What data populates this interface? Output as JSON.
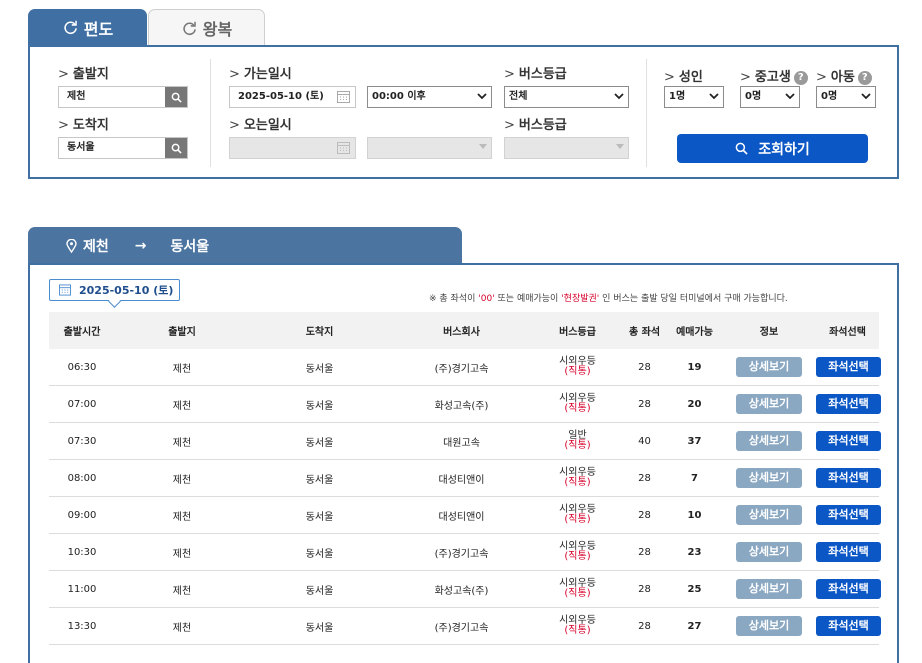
{
  "tabs": {
    "oneway": "편도",
    "roundtrip": "왕복"
  },
  "search": {
    "departure_label": "출발지",
    "departure_value": "제천",
    "arrival_label": "도착지",
    "arrival_value": "동서울",
    "go_date_label": "가는일시",
    "go_date_value": "2025-05-10 (토)",
    "go_time_value": "00:00 이후",
    "return_date_label": "오는일시",
    "grade_label": "버스등급",
    "grade_value": "전체",
    "grade_label2": "버스등급",
    "adult_label": "성인",
    "adult_value": "1명",
    "youth_label": "중고생",
    "youth_value": "0명",
    "child_label": "아동",
    "child_value": "0명",
    "help": "?",
    "submit": "조회하기"
  },
  "route": {
    "from": "제천",
    "arrow": "→",
    "to": "동서울"
  },
  "result_date": "2025-05-10 (토)",
  "notice": {
    "prefix": "※ 총 좌석이 ",
    "zero": "'00'",
    "mid": " 또는 예매가능이 ",
    "onsite": "'현장발권'",
    "suffix": " 인 버스는 출발 당일 터미널에서 구매 가능합니다."
  },
  "table": {
    "headers": [
      "출발시간",
      "출발지",
      "도착지",
      "버스회사",
      "버스등급",
      "총 좌석",
      "예매가능",
      "정보",
      "좌석선택"
    ],
    "detail_label": "상세보기",
    "seat_label": "좌석선택",
    "rows": [
      {
        "time": "06:30",
        "from": "제천",
        "to": "동서울",
        "company": "(주)경기고속",
        "grade": "시외우등",
        "grade_sub": "(직통)",
        "total": "28",
        "avail": "19"
      },
      {
        "time": "07:00",
        "from": "제천",
        "to": "동서울",
        "company": "화성고속(주)",
        "grade": "시외우등",
        "grade_sub": "(직통)",
        "total": "28",
        "avail": "20"
      },
      {
        "time": "07:30",
        "from": "제천",
        "to": "동서울",
        "company": "대원고속",
        "grade": "일반",
        "grade_sub": "(직통)",
        "total": "40",
        "avail": "37"
      },
      {
        "time": "08:00",
        "from": "제천",
        "to": "동서울",
        "company": "대성티앤이",
        "grade": "시외우등",
        "grade_sub": "(직통)",
        "total": "28",
        "avail": "7"
      },
      {
        "time": "09:00",
        "from": "제천",
        "to": "동서울",
        "company": "대성티앤이",
        "grade": "시외우등",
        "grade_sub": "(직통)",
        "total": "28",
        "avail": "10"
      },
      {
        "time": "10:30",
        "from": "제천",
        "to": "동서울",
        "company": "(주)경기고속",
        "grade": "시외우등",
        "grade_sub": "(직통)",
        "total": "28",
        "avail": "23"
      },
      {
        "time": "11:00",
        "from": "제천",
        "to": "동서울",
        "company": "화성고속(주)",
        "grade": "시외우등",
        "grade_sub": "(직통)",
        "total": "28",
        "avail": "25"
      },
      {
        "time": "13:30",
        "from": "제천",
        "to": "동서울",
        "company": "(주)경기고속",
        "grade": "시외우등",
        "grade_sub": "(직통)",
        "total": "28",
        "avail": "27"
      }
    ]
  }
}
